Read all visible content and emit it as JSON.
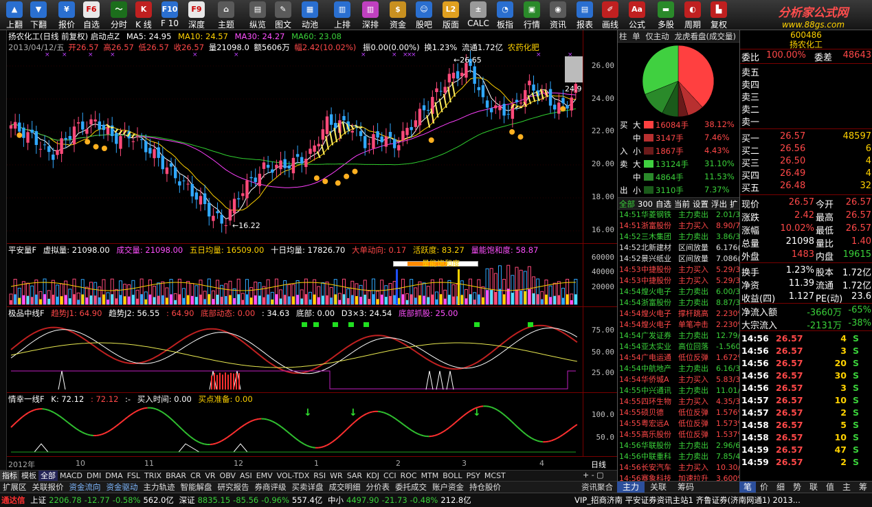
{
  "toolbar": {
    "items": [
      {
        "label": "上翻",
        "icon": "arrow-up-icon",
        "color": "#2a6fd0",
        "glyph": "▲"
      },
      {
        "label": "下翻",
        "icon": "arrow-down-icon",
        "color": "#2a6fd0",
        "glyph": "▼"
      },
      {
        "label": "报价",
        "icon": "price-icon",
        "color": "#2a6fd0",
        "glyph": "¥"
      },
      {
        "label": "自选",
        "icon": "f6-icon",
        "color": "#e8e8e8",
        "glyph": "F6"
      },
      {
        "label": "分时",
        "icon": "timeshare-icon",
        "color": "#1c6e1c",
        "glyph": "〜"
      },
      {
        "label": "K 线",
        "icon": "kline-icon",
        "color": "#c02020",
        "glyph": "K"
      },
      {
        "label": "F 10",
        "icon": "f10-icon",
        "color": "#2a6fd0",
        "glyph": "F10"
      },
      {
        "label": "深度",
        "icon": "f9-icon",
        "color": "#e8e8e8",
        "glyph": "F9"
      },
      {
        "label": "主题",
        "icon": "theme-icon",
        "color": "#5a5a5a",
        "glyph": "⌂"
      },
      {
        "label": "纵览",
        "icon": "overview-icon",
        "color": "#5a5a5a",
        "glyph": "▤"
      },
      {
        "label": "图文",
        "icon": "graphic-icon",
        "color": "#5a5a5a",
        "glyph": "✎"
      },
      {
        "label": "动池",
        "icon": "pool-icon",
        "color": "#2a6fd0",
        "glyph": "▦"
      },
      {
        "label": "上排",
        "icon": "rank-icon",
        "color": "#2a6fd0",
        "glyph": "▥"
      },
      {
        "label": "深排",
        "icon": "deep-rank-icon",
        "color": "#c040c0",
        "glyph": "▥"
      },
      {
        "label": "资金",
        "icon": "fund-icon",
        "color": "#c89020",
        "glyph": "$"
      },
      {
        "label": "股吧",
        "icon": "forum-icon",
        "color": "#2a6fd0",
        "glyph": "☺"
      },
      {
        "label": "版面",
        "icon": "layout-l2-icon",
        "color": "#e0a020",
        "glyph": "L2"
      },
      {
        "label": "CALC",
        "icon": "calculator-icon",
        "color": "#9a9a9a",
        "glyph": "±"
      },
      {
        "label": "板指",
        "icon": "sector-icon",
        "color": "#2a6fd0",
        "glyph": "◔"
      },
      {
        "label": "行情",
        "icon": "market-icon",
        "color": "#2a8a2a",
        "glyph": "▣"
      },
      {
        "label": "资讯",
        "icon": "news-icon",
        "color": "#5a5a5a",
        "glyph": "◉"
      },
      {
        "label": "报表",
        "icon": "report-icon",
        "color": "#2a6fd0",
        "glyph": "▤"
      },
      {
        "label": "画线",
        "icon": "draw-icon",
        "color": "#c02020",
        "glyph": "✐"
      },
      {
        "label": "公式",
        "icon": "formula-icon",
        "color": "#c02020",
        "glyph": "Aa"
      },
      {
        "label": "多股",
        "icon": "multi-icon",
        "color": "#2a8a2a",
        "glyph": "▬"
      },
      {
        "label": "周期",
        "icon": "period-icon",
        "color": "#c02020",
        "glyph": "◐"
      },
      {
        "label": "复权",
        "icon": "restore-icon",
        "color": "#c02020",
        "glyph": "▙"
      }
    ],
    "brand_name": "分析家公式网",
    "brand_url": "www.88gs.com"
  },
  "chart_info": {
    "line1": "扬农化工(日线 前复权) 启动点Z",
    "ma5": "MA5: 24.95",
    "ma10": "MA10: 24.57",
    "ma30": "MA30: 24.27",
    "ma60": "MA60: 23.08",
    "date": "2013/04/12/五",
    "open": "开26.57",
    "high": "高26.57",
    "low": "低26.57",
    "close": "收26.57",
    "vol": "量21098.0",
    "amt": "额5606万",
    "amp": "幅2.42(10.02%)",
    "zhen": "振0.00(0.00%)",
    "huan": "换1.23%",
    "liutong": "流通1.72亿",
    "sector": "农药化肥"
  },
  "main_ticks": [
    "26.00",
    "24.00",
    "22.00",
    "20.00",
    "18.00",
    "16.00"
  ],
  "marks": {
    "high": "26.65",
    "low": "16.22",
    "last": "24.9"
  },
  "vol_info": {
    "name": "平安量F",
    "virtual": "虚拟量: 21098.00",
    "deal": "成交量: 21098.00",
    "five": "五日均量: 16509.00",
    "ten": "十日均量: 17826.70",
    "big": "大单动向: 0.17",
    "active": "活跃度: 83.27",
    "sat": "量能饱和度: 58.87",
    "sat_box": "量能饱和度"
  },
  "vol_ticks": [
    "60000",
    "40000",
    "20000"
  ],
  "ind_info": {
    "name": "极品中线F",
    "j1": "趋势J1: 64.90",
    "j2": "趋势J2: 56.55",
    "j2v": ": 64.90",
    "dd": "底部动态: 0.00",
    "ddv": ": 34.63",
    "db": "底部: 0.00",
    "d3": "D3×3: 24.54",
    "zd": "底部抓股: 25.00"
  },
  "ind_ticks": [
    "75.00",
    "50.00",
    "25.00"
  ],
  "q_info": {
    "name": "情幸一线F",
    "k": "K: 72.12",
    "kv": ": 72.12",
    "sep": ":-",
    "buy": "买入时间: 0.00",
    "ready": "买点准备: 0.00"
  },
  "q_ticks": [
    "100.0",
    "50.0"
  ],
  "dates": [
    {
      "label": "2012年",
      "color": "#aaa"
    },
    {
      "label": "10",
      "color": "#aaa"
    },
    {
      "label": "11",
      "color": "#aaa"
    },
    {
      "label": "12",
      "color": "#aaa"
    },
    {
      "label": "1",
      "color": "#aaa"
    },
    {
      "label": "2",
      "color": "#aaa"
    },
    {
      "label": "3",
      "color": "#aaa"
    },
    {
      "label": "4",
      "color": "#aaa"
    }
  ],
  "dates_right": "日线",
  "ind_tabs": [
    "指标",
    "模板",
    "全部",
    "MACD",
    "DMI",
    "DMA",
    "FSL",
    "TRIX",
    "BRAR",
    "CR",
    "VR",
    "OBV",
    "ASI",
    "EMV",
    "VOL-TDX",
    "RSI",
    "WR",
    "SAR",
    "KDJ",
    "CCI",
    "ROC",
    "MTM",
    "BOLL",
    "PSY",
    "MCST"
  ],
  "ind_tabs_right": "+ - ▢",
  "func_tabs": [
    "扩展区",
    "关联报价",
    "资金流向",
    "资金驱动",
    "主力轨迹",
    "智能解盘",
    "研究报告",
    "券商评级",
    "买卖详盘",
    "成交明细",
    "分价表",
    "委托成交",
    "账户资金",
    "持仓股价"
  ],
  "func_right": "资讯聚合",
  "status": {
    "app": "通达信",
    "sh": "上证",
    "sh_v": "2206.78",
    "sh_c": "-12.77",
    "sh_p": "-0.58%",
    "sh_a": "562.0亿",
    "sz": "深证",
    "sz_v": "8835.15",
    "sz_c": "-85.56",
    "sz_p": "-0.96%",
    "sz_a": "557.4亿",
    "zx": "中小",
    "zx_v": "4497.90",
    "zx_c": "-21.73",
    "zx_p": "-0.48%",
    "zx_a": "212.8亿",
    "msg": "VIP_招商济南  平安证券资讯主站1  齐鲁证券(济南网通1) 2013..."
  },
  "right_panel": {
    "tabs": [
      "柱",
      "单",
      "仅主动",
      "龙虎看盘(成交量)"
    ],
    "pie": [
      {
        "name": "大买",
        "percent": 38.12,
        "color": "#ff4040"
      },
      {
        "name": "中买",
        "percent": 7.46,
        "color": "#b83030"
      },
      {
        "name": "小买",
        "percent": 4.43,
        "color": "#6a1a1a"
      },
      {
        "name": "小卖",
        "percent": 7.37,
        "color": "#1a5a1a"
      },
      {
        "name": "中卖",
        "percent": 11.53,
        "color": "#2a8a2a"
      },
      {
        "name": "大卖",
        "percent": 31.1,
        "color": "#40d040"
      }
    ],
    "flow_rows": [
      {
        "side": "买",
        "size": "大",
        "vol": "16084手",
        "pct": "38.12%",
        "color": "#ff4040"
      },
      {
        "side": "",
        "size": "中",
        "vol": "3147手",
        "pct": "7.46%",
        "color": "#b83030"
      },
      {
        "side": "入",
        "size": "小",
        "vol": "1867手",
        "pct": "4.43%",
        "color": "#6a1a1a"
      },
      {
        "side": "卖",
        "size": "大",
        "vol": "13124手",
        "pct": "31.10%",
        "color": "#40d040"
      },
      {
        "side": "",
        "size": "中",
        "vol": "4864手",
        "pct": "11.53%",
        "color": "#2a8a2a"
      },
      {
        "side": "出",
        "size": "小",
        "vol": "3110手",
        "pct": "7.37%",
        "color": "#1a5a1a"
      }
    ],
    "list_tabs": [
      "全部",
      "300",
      "自选",
      "当前",
      "设置",
      "浮出",
      "扩"
    ],
    "alerts": [
      {
        "t": "14:51",
        "n": "华菱钢铁",
        "a": "主力卖出",
        "v": "2.01/3",
        "c": "g"
      },
      {
        "t": "14:51",
        "n": "浙富股份",
        "a": "主力买入",
        "v": "8.90/7",
        "c": "r"
      },
      {
        "t": "14:52",
        "n": "三木集团",
        "a": "主力卖出",
        "v": "3.86/3",
        "c": "g"
      },
      {
        "t": "14:52",
        "n": "北新建材",
        "a": "区间放量",
        "v": "6.176(",
        "c": "w"
      },
      {
        "t": "14:52",
        "n": "景兴纸业",
        "a": "区间放量",
        "v": "7.086(",
        "c": "w"
      },
      {
        "t": "14:53",
        "n": "中捷股份",
        "a": "主力买入",
        "v": "5.29/3",
        "c": "r"
      },
      {
        "t": "14:53",
        "n": "中捷股份",
        "a": "主力买入",
        "v": "5.29/3",
        "c": "r"
      },
      {
        "t": "14:54",
        "n": "煌火电子",
        "a": "主力卖出",
        "v": "6.00/3",
        "c": "g"
      },
      {
        "t": "14:54",
        "n": "浙富股份",
        "a": "主力卖出",
        "v": "8.87/3",
        "c": "g"
      },
      {
        "t": "14:54",
        "n": "煌火电子",
        "a": "撑杆跳高",
        "v": "2.230%",
        "c": "r"
      },
      {
        "t": "14:54",
        "n": "煌火电子",
        "a": "单笔冲击",
        "v": "2.230%",
        "c": "r"
      },
      {
        "t": "14:54",
        "n": "广发证券",
        "a": "主力卖出",
        "v": "12.79/",
        "c": "g"
      },
      {
        "t": "14:54",
        "n": "亚太实业",
        "a": "高位回落",
        "v": "-1.560",
        "c": "g"
      },
      {
        "t": "14:54",
        "n": "广电运通",
        "a": "低位反弹",
        "v": "1.672%",
        "c": "r"
      },
      {
        "t": "14:54",
        "n": "中航地产",
        "a": "主力卖出",
        "v": "6.16/3",
        "c": "g"
      },
      {
        "t": "14:54",
        "n": "华侨城A",
        "a": "主力买入",
        "v": "5.83/3",
        "c": "r"
      },
      {
        "t": "14:55",
        "n": "中兴通讯",
        "a": "主力卖出",
        "v": "11.01/",
        "c": "g"
      },
      {
        "t": "14:55",
        "n": "四环生物",
        "a": "主力买入",
        "v": "4.35/3",
        "c": "r"
      },
      {
        "t": "14:55",
        "n": "硕贝德",
        "a": "低位反弹",
        "v": "1.576%",
        "c": "r"
      },
      {
        "t": "14:55",
        "n": "粤宏远A",
        "a": "低位反弹",
        "v": "1.573%",
        "c": "r"
      },
      {
        "t": "14:55",
        "n": "高乐股份",
        "a": "低位反弹",
        "v": "1.537%",
        "c": "r"
      },
      {
        "t": "14:56",
        "n": "华联股份",
        "a": "主力卖出",
        "v": "2.96/6",
        "c": "g"
      },
      {
        "t": "14:56",
        "n": "中联重科",
        "a": "主力卖出",
        "v": "7.85/4",
        "c": "g"
      },
      {
        "t": "14:56",
        "n": "长安汽车",
        "a": "主力买入",
        "v": "10.30/",
        "c": "r"
      },
      {
        "t": "14:56",
        "n": "赛象科技",
        "a": "加速拉升",
        "v": "3.600%",
        "c": "r"
      },
      {
        "t": "14:56",
        "n": "TCL 集团",
        "a": "主力买入",
        "v": "2.71/8",
        "c": "r"
      }
    ]
  },
  "quote": {
    "code": "600486",
    "name": "扬农化工",
    "weibi_l": "委比",
    "weibi": "100.00%",
    "weicha_l": "委差",
    "weicha": "48643",
    "sells": [
      "卖五",
      "卖四",
      "卖三",
      "卖二",
      "卖一"
    ],
    "buys": [
      {
        "l": "买一",
        "p": "26.57",
        "v": "48597"
      },
      {
        "l": "买二",
        "p": "26.56",
        "v": "6"
      },
      {
        "l": "买三",
        "p": "26.50",
        "v": "4"
      },
      {
        "l": "买四",
        "p": "26.49",
        "v": "4"
      },
      {
        "l": "买五",
        "p": "26.48",
        "v": "32"
      }
    ],
    "stats": [
      {
        "l1": "现价",
        "v1": "26.57",
        "c1": "r",
        "l2": "今开",
        "v2": "26.57",
        "c2": "r"
      },
      {
        "l1": "涨跌",
        "v1": "2.42",
        "c1": "r",
        "l2": "最高",
        "v2": "26.57",
        "c2": "r"
      },
      {
        "l1": "涨幅",
        "v1": "10.02%",
        "c1": "r",
        "l2": "最低",
        "v2": "26.57",
        "c2": "r"
      },
      {
        "l1": "总量",
        "v1": "21098",
        "c1": "w",
        "l2": "量比",
        "v2": "1.40",
        "c2": "r"
      },
      {
        "l1": "外盘",
        "v1": "1483",
        "c1": "r",
        "l2": "内盘",
        "v2": "19615",
        "c2": "g"
      },
      {
        "l1": "换手",
        "v1": "1.23%",
        "c1": "w",
        "l2": "股本",
        "v2": "1.72亿",
        "c2": "w"
      },
      {
        "l1": "净资",
        "v1": "11.39",
        "c1": "w",
        "l2": "流通",
        "v2": "1.72亿",
        "c2": "w"
      },
      {
        "l1": "收益(四)",
        "v1": "1.127",
        "c1": "w",
        "l2": "PE(动)",
        "v2": "23.6",
        "c2": "w"
      }
    ],
    "netflow_l": "净流入额",
    "netflow": "-3660万",
    "netflow_p": "-65%",
    "bulk_l": "大宗流入",
    "bulk": "-2131万",
    "bulk_p": "-38%",
    "ticks": [
      {
        "t": "14:56",
        "p": "26.57",
        "v": "4",
        "s": "S"
      },
      {
        "t": "14:56",
        "p": "26.57",
        "v": "3",
        "s": "S"
      },
      {
        "t": "14:56",
        "p": "26.57",
        "v": "20",
        "s": "S"
      },
      {
        "t": "14:56",
        "p": "26.57",
        "v": "30",
        "s": "S"
      },
      {
        "t": "14:56",
        "p": "26.57",
        "v": "3",
        "s": "S"
      },
      {
        "t": "14:57",
        "p": "26.57",
        "v": "10",
        "s": "S"
      },
      {
        "t": "14:57",
        "p": "26.57",
        "v": "2",
        "s": "S"
      },
      {
        "t": "14:58",
        "p": "26.57",
        "v": "5",
        "s": "S"
      },
      {
        "t": "14:58",
        "p": "26.57",
        "v": "10",
        "s": "S"
      },
      {
        "t": "14:59",
        "p": "26.57",
        "v": "47",
        "s": "S"
      },
      {
        "t": "14:59",
        "p": "26.57",
        "v": "2",
        "s": "S"
      }
    ],
    "bottom_tabs": [
      "笔",
      "价",
      "细",
      "势",
      "联",
      "值",
      "主",
      "筹"
    ],
    "rp_bottom_tabs": [
      "主力",
      "关联",
      "筹码"
    ]
  }
}
